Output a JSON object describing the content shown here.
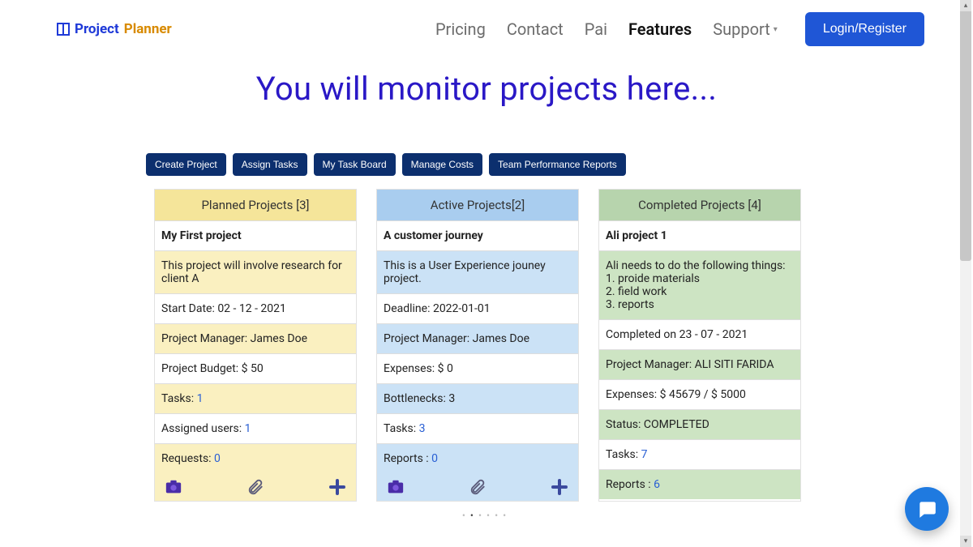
{
  "brand": {
    "word1": "Project",
    "word2": "Planner"
  },
  "nav": {
    "pricing": "Pricing",
    "contact": "Contact",
    "pai": "Pai",
    "features": "Features",
    "support": "Support",
    "caret": "▾"
  },
  "login_label": "Login/Register",
  "hero": "You will monitor projects here...",
  "actions": {
    "create_project": "Create Project",
    "assign_tasks": "Assign Tasks",
    "my_task_board": "My Task Board",
    "manage_costs": "Manage Costs",
    "team_performance_reports": "Team Performance Reports"
  },
  "columns": {
    "planned": {
      "header": "Planned Projects [3]",
      "title": "My First project",
      "desc": "This project will involve research for client A",
      "start_date": "Start Date: 02 - 12 - 2021",
      "pm": "Project Manager: James Doe",
      "budget": "Project Budget: $ 50",
      "tasks_label": "Tasks: ",
      "tasks_val": "1",
      "assigned_label": "Assigned users: ",
      "assigned_val": "1",
      "requests_label": "Requests: ",
      "requests_val": "0"
    },
    "active": {
      "header": "Active Projects[2]",
      "title": "A customer journey",
      "desc": "This is a User Experience jouney project.",
      "deadline": "Deadline: 2022-01-01",
      "pm": "Project Manager: James Doe",
      "expenses": "Expenses: $ 0",
      "bottlenecks": "Bottlenecks: 3",
      "tasks_label": "Tasks: ",
      "tasks_val": "3",
      "reports_label": "Reports : ",
      "reports_val": "0"
    },
    "completed": {
      "header": "Completed Projects [4]",
      "title": "Ali project 1",
      "desc_l1": "Ali needs to do the following things:",
      "desc_l2": "1. proide materials",
      "desc_l3": "2. field work",
      "desc_l4": "3. reports",
      "completed_on": "Completed on 23 - 07 - 2021",
      "pm": "Project Manager: ALI SITI FARIDA",
      "expenses": "Expenses: $ 45679 / $ 5000",
      "status": "Status: COMPLETED",
      "tasks_label": "Tasks: ",
      "tasks_val": "7",
      "reports_label": "Reports : ",
      "reports_val": "6"
    }
  },
  "dots": {
    "d1": "•",
    "d2": "•",
    "d3": "•",
    "d4": "•",
    "d5": "•",
    "d6": "•"
  }
}
